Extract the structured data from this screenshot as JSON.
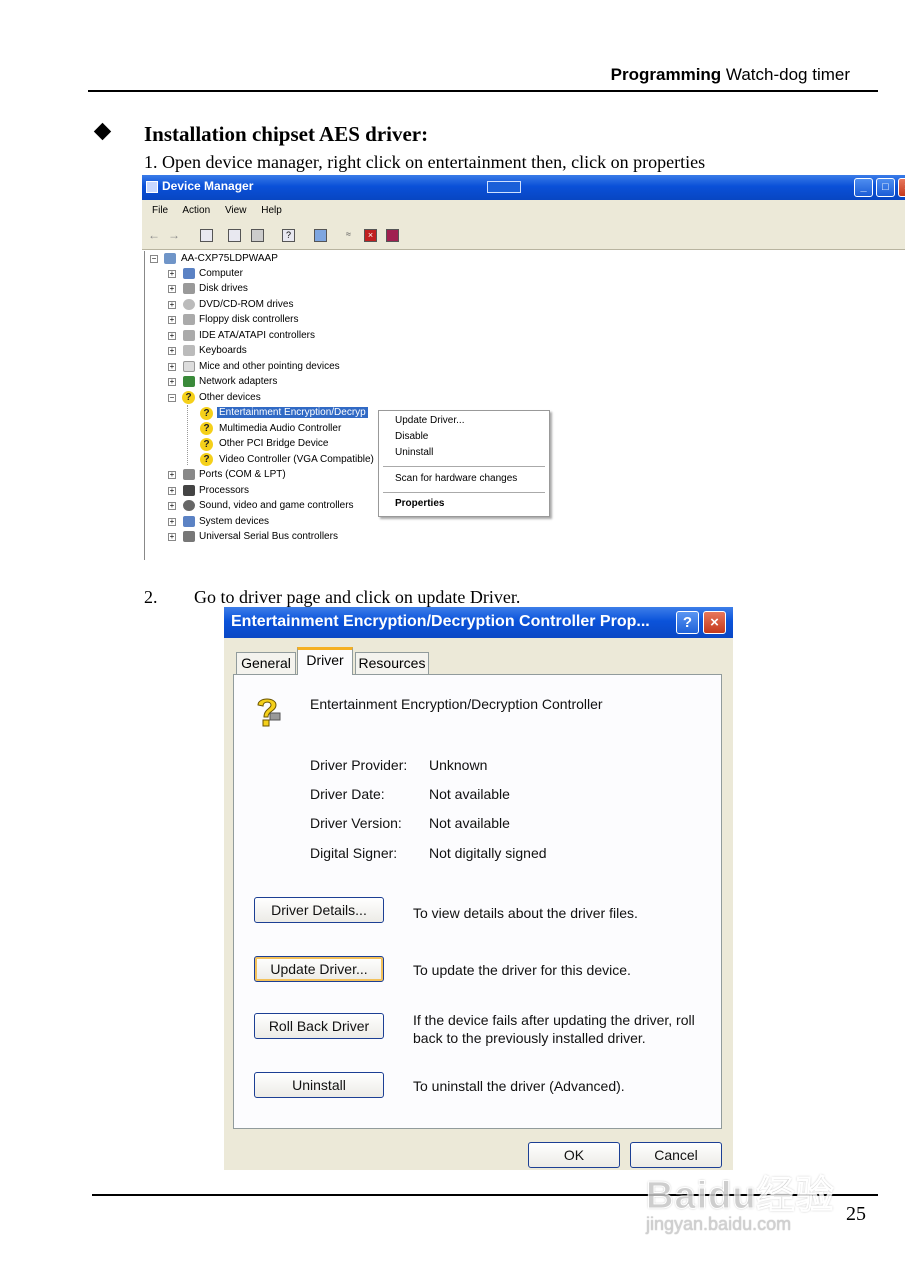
{
  "header": {
    "bold": "Programming",
    "rest": " Watch-dog timer"
  },
  "section_title": "Installation chipset AES driver:",
  "step1": "1.  Open device manager, right click on entertainment then, click on properties",
  "step2": {
    "num": "2.",
    "text": "Go to driver page and click on update Driver."
  },
  "device_manager": {
    "title": "Device Manager",
    "window_buttons": [
      "_",
      "□",
      "×"
    ],
    "menu": [
      "File",
      "Action",
      "View",
      "Help"
    ],
    "tree": {
      "root": "AA-CXP75LDPWAAP",
      "categories_before": [
        "Computer",
        "Disk drives",
        "DVD/CD-ROM drives",
        "Floppy disk controllers",
        "IDE ATA/ATAPI controllers",
        "Keyboards",
        "Mice and other pointing devices",
        "Network adapters",
        "Other devices"
      ],
      "other_devices": [
        "Entertainment Encryption/Decryp",
        "Multimedia Audio Controller",
        "Other PCI Bridge Device",
        "Video Controller (VGA Compatible)"
      ],
      "categories_after": [
        "Ports (COM & LPT)",
        "Processors",
        "Sound, video and game controllers",
        "System devices",
        "Universal Serial Bus controllers"
      ]
    },
    "context_menu": {
      "update_driver": "Update Driver...",
      "disable": "Disable",
      "uninstall": "Uninstall",
      "scan": "Scan for hardware changes",
      "properties": "Properties"
    }
  },
  "properties_dialog": {
    "title": "Entertainment Encryption/Decryption Controller Prop...",
    "help_button": "?",
    "close_button": "×",
    "tabs": [
      "General",
      "Driver",
      "Resources"
    ],
    "active_tab": "Driver",
    "device_name": "Entertainment Encryption/Decryption Controller",
    "fields": [
      {
        "label": "Driver Provider:",
        "value": "Unknown"
      },
      {
        "label": "Driver Date:",
        "value": "Not available"
      },
      {
        "label": "Driver Version:",
        "value": "Not available"
      },
      {
        "label": "Digital Signer:",
        "value": "Not digitally signed"
      }
    ],
    "actions": [
      {
        "button": "Driver Details...",
        "desc": "To view details about the driver files."
      },
      {
        "button": "Update Driver...",
        "desc": "To update the driver for this device."
      },
      {
        "button": "Roll Back Driver",
        "desc": "If the device fails after updating the driver, roll back to the previously installed driver."
      },
      {
        "button": "Uninstall",
        "desc": "To uninstall the driver (Advanced)."
      }
    ],
    "ok": "OK",
    "cancel": "Cancel"
  },
  "page_number": "25",
  "watermark": {
    "main": "Baidu经验",
    "sub": "jingyan.baidu.com"
  }
}
